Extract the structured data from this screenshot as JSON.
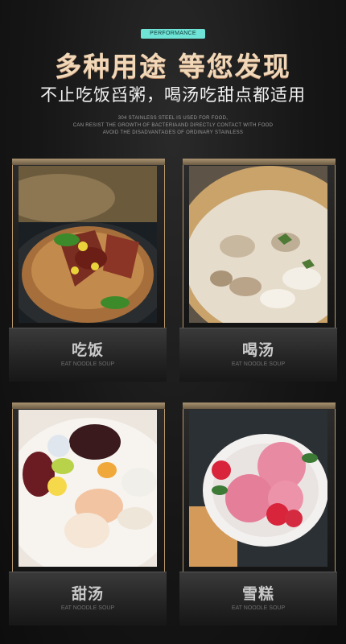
{
  "header": {
    "badge": "PERFORMANCE",
    "title": "多种用途 等您发现",
    "subtitle": "不止吃饭舀粥，喝汤吃甜点都适用",
    "desc_lines": [
      "304 STAINLESS STEEL IS USED FOR FOOD,",
      "CAN RESIST THE GROWTH OF BACTERIAAND DIRECTLY CONTACT WITH FOOD",
      "AVOID THE DISADVANTAGES OF ORDINARY STAINLESS"
    ]
  },
  "cards": [
    {
      "label_cn": "吃饭",
      "label_en": "EAT NOODLE SOUP",
      "icon": "rice-bowl-photo"
    },
    {
      "label_cn": "喝汤",
      "label_en": "EAT NOODLE SOUP",
      "icon": "soup-photo"
    },
    {
      "label_cn": "甜汤",
      "label_en": "EAT NOODLE SOUP",
      "icon": "sweet-soup-photo"
    },
    {
      "label_cn": "雪糕",
      "label_en": "EAT NOODLE SOUP",
      "icon": "ice-cream-photo"
    }
  ],
  "colors": {
    "accent": "#6fe3d6",
    "title_gold": "#f0d7b8",
    "frame_gold": "#b9986c",
    "background": "#161616"
  }
}
